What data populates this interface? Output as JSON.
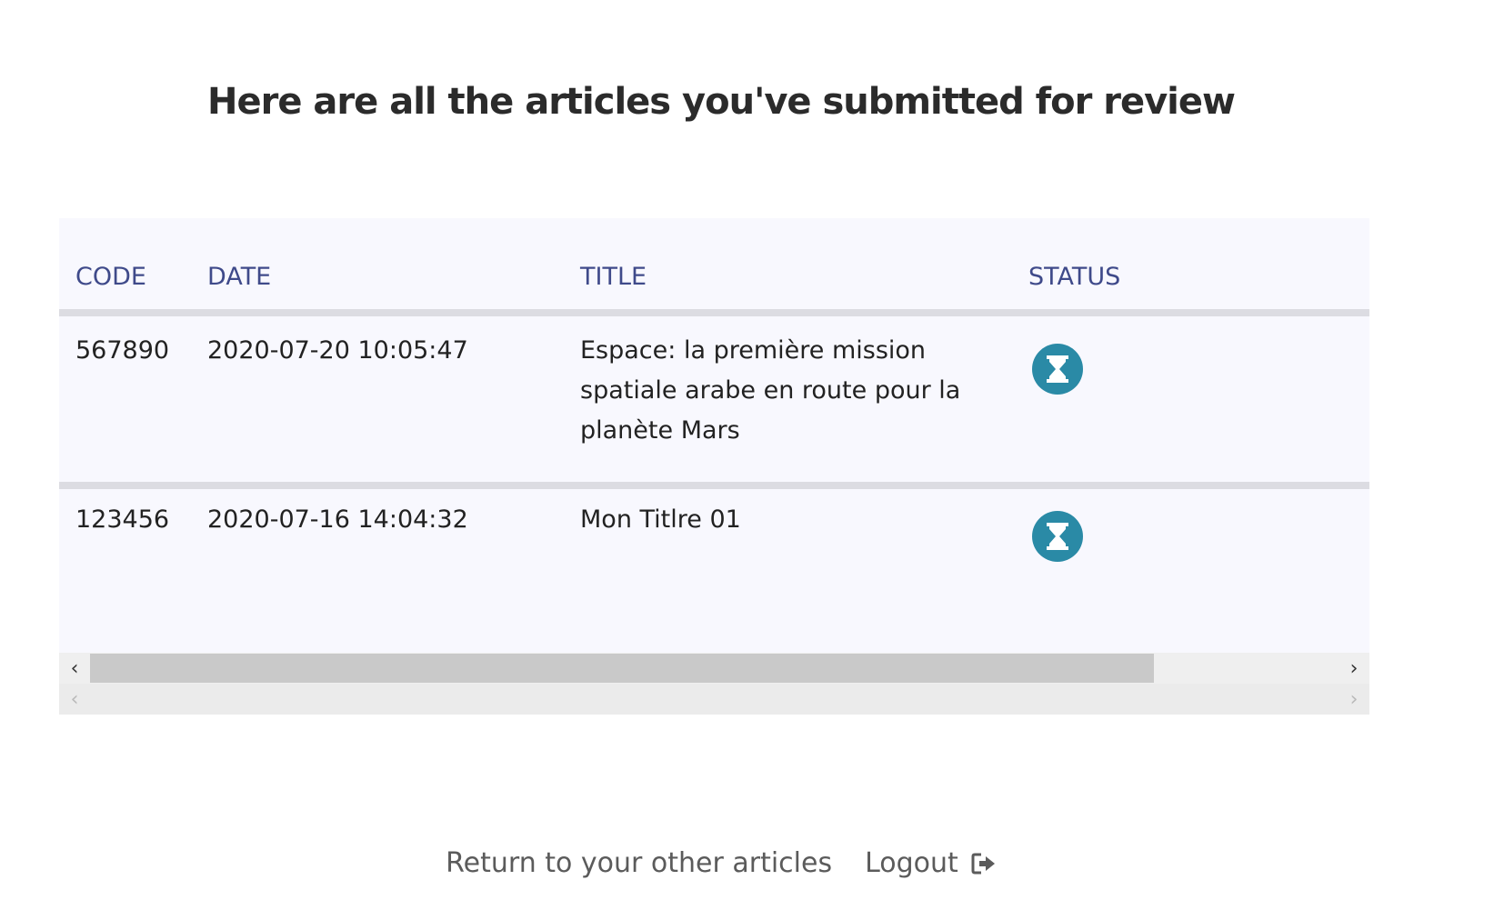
{
  "page": {
    "title": "Here are all the articles you've submitted for review"
  },
  "table": {
    "headers": {
      "code": "CODE",
      "date": "DATE",
      "title": "TITLE",
      "status": "STATUS"
    },
    "rows": [
      {
        "code": "567890",
        "date": "2020-07-20 10:05:47",
        "title": "Espace: la première mission spatiale arabe en route pour la planète Mars",
        "status_icon": "hourglass-icon"
      },
      {
        "code": "123456",
        "date": "2020-07-16 14:04:32",
        "title": "Mon Titlre 01",
        "status_icon": "hourglass-icon"
      }
    ],
    "scrollbar": {
      "left_arrow": "‹",
      "right_arrow": "›",
      "thumb_fraction": 0.81
    },
    "secondary_scrollbar": {
      "left_arrow": "‹",
      "right_arrow": "›"
    }
  },
  "footer": {
    "return_link": "Return to your other articles",
    "logout_link": "Logout",
    "logout_icon": "sign-out-icon"
  },
  "colors": {
    "header_text": "#3f4a8a",
    "status_icon_bg": "#2a8aa6",
    "table_bg": "#f8f8fe",
    "separator": "#dcdce2"
  }
}
